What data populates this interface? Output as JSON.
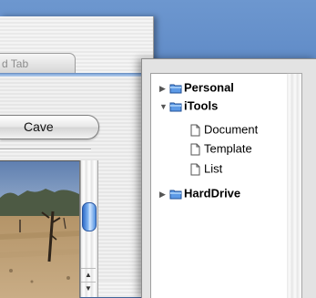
{
  "back_window": {
    "tab_label": "d Tab",
    "button_label": "Cave"
  },
  "outline": {
    "items": [
      {
        "label": "Personal",
        "icon": "folder-icon",
        "expanded": false
      },
      {
        "label": "iTools",
        "icon": "folder-icon",
        "expanded": true
      },
      {
        "label": "Document",
        "icon": "document-icon"
      },
      {
        "label": "Template",
        "icon": "document-icon"
      },
      {
        "label": "List",
        "icon": "document-icon"
      },
      {
        "label": "HardDrive",
        "icon": "folder-icon",
        "expanded": false
      }
    ]
  },
  "colors": {
    "desktop": "#5581c0",
    "accent": "#3a78d8",
    "folder": "#4a8ee0"
  }
}
